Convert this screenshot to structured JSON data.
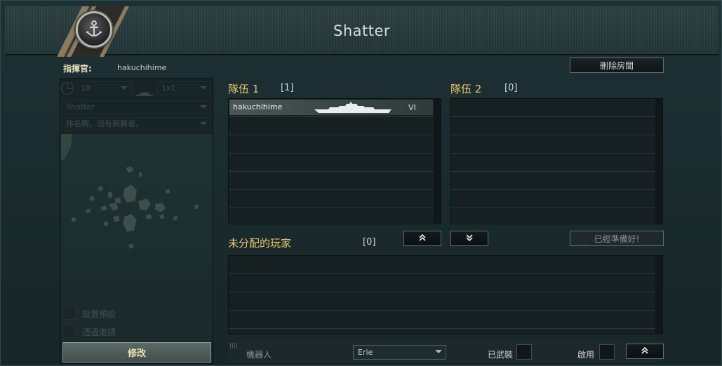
{
  "window": {
    "title": "Shatter"
  },
  "commander": {
    "label": "指揮官:",
    "name": "hakuchihime"
  },
  "buttons": {
    "delete_room": "刪除房間",
    "ready": "已經準備好!",
    "modify": "修改"
  },
  "left_panel": {
    "tier_select": "10",
    "team_size_select": "1x1",
    "map_select": "Shatter",
    "battle_type_select": "排名戰，沒有競賽者。",
    "options": [
      {
        "label": "設置預設"
      },
      {
        "label": "透過邀請"
      }
    ]
  },
  "team1": {
    "title": "隊伍 1",
    "count": "[1]",
    "players": [
      {
        "name": "hakuchihime",
        "tier": "VI"
      }
    ]
  },
  "team2": {
    "title": "隊伍 2",
    "count": "[0]",
    "players": []
  },
  "unassigned": {
    "title": "未分配的玩家",
    "count": "[0]"
  },
  "bottom_bar": {
    "bot_label": "機器人",
    "bot_select": "Erie",
    "armed_label": "已武裝",
    "enable_label": "啟用"
  },
  "colors": {
    "accent_gold": "#e8c96a",
    "panel_bg": "#162022",
    "player_row": "#4a5755"
  }
}
